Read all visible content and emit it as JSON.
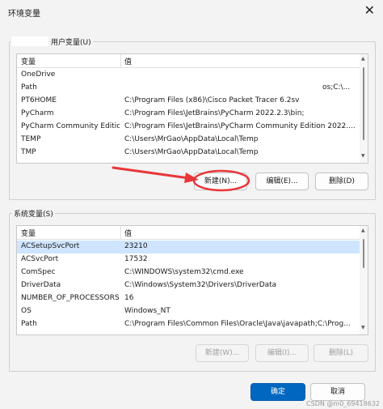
{
  "window": {
    "title": "环境变量",
    "close_glyph": "✕"
  },
  "user_vars": {
    "group_label": "用户变量(U)",
    "columns": [
      "变量",
      "值"
    ],
    "rows": [
      {
        "name": "OneDrive",
        "value": ""
      },
      {
        "name": "Path",
        "value": "",
        "value_right": "os;C:\\..."
      },
      {
        "name": "PT6HOME",
        "value": "C:\\Program Files (x86)\\Cisco Packet Tracer 6.2sv"
      },
      {
        "name": "PyCharm",
        "value": "C:\\Program Files\\JetBrains\\PyCharm 2022.2.3\\bin;"
      },
      {
        "name": "PyCharm Community Edition",
        "value": "C:\\Program Files\\JetBrains\\PyCharm Community Edition 2022...."
      },
      {
        "name": "TEMP",
        "value": "C:\\Users\\MrGao\\AppData\\Local\\Temp"
      },
      {
        "name": "TMP",
        "value": "C:\\Users\\MrGao\\AppData\\Local\\Temp"
      }
    ],
    "buttons": {
      "new": "新建(N)...",
      "edit": "编辑(E)...",
      "delete": "删除(D)"
    }
  },
  "system_vars": {
    "group_label": "系统变量(S)",
    "columns": [
      "变量",
      "值"
    ],
    "rows": [
      {
        "name": "ACSetupSvcPort",
        "value": "23210"
      },
      {
        "name": "ACSvcPort",
        "value": "17532"
      },
      {
        "name": "ComSpec",
        "value": "C:\\WINDOWS\\system32\\cmd.exe"
      },
      {
        "name": "DriverData",
        "value": "C:\\Windows\\System32\\Drivers\\DriverData"
      },
      {
        "name": "NUMBER_OF_PROCESSORS",
        "value": "16"
      },
      {
        "name": "OS",
        "value": "Windows_NT"
      },
      {
        "name": "Path",
        "value": "C:\\Program Files\\Common Files\\Oracle\\Java\\javapath;C:\\Prog..."
      }
    ],
    "selected_row": 0,
    "buttons": {
      "new": "新建(W)...",
      "edit": "编辑(I)...",
      "delete": "删除(L)"
    }
  },
  "footer": {
    "ok": "确定",
    "cancel": "取消"
  },
  "watermark": "CSDN @m0_69418632",
  "colors": {
    "annotation_arrow": "#e8363a",
    "accent": "#0067c0",
    "selection": "#cfe5ff"
  }
}
